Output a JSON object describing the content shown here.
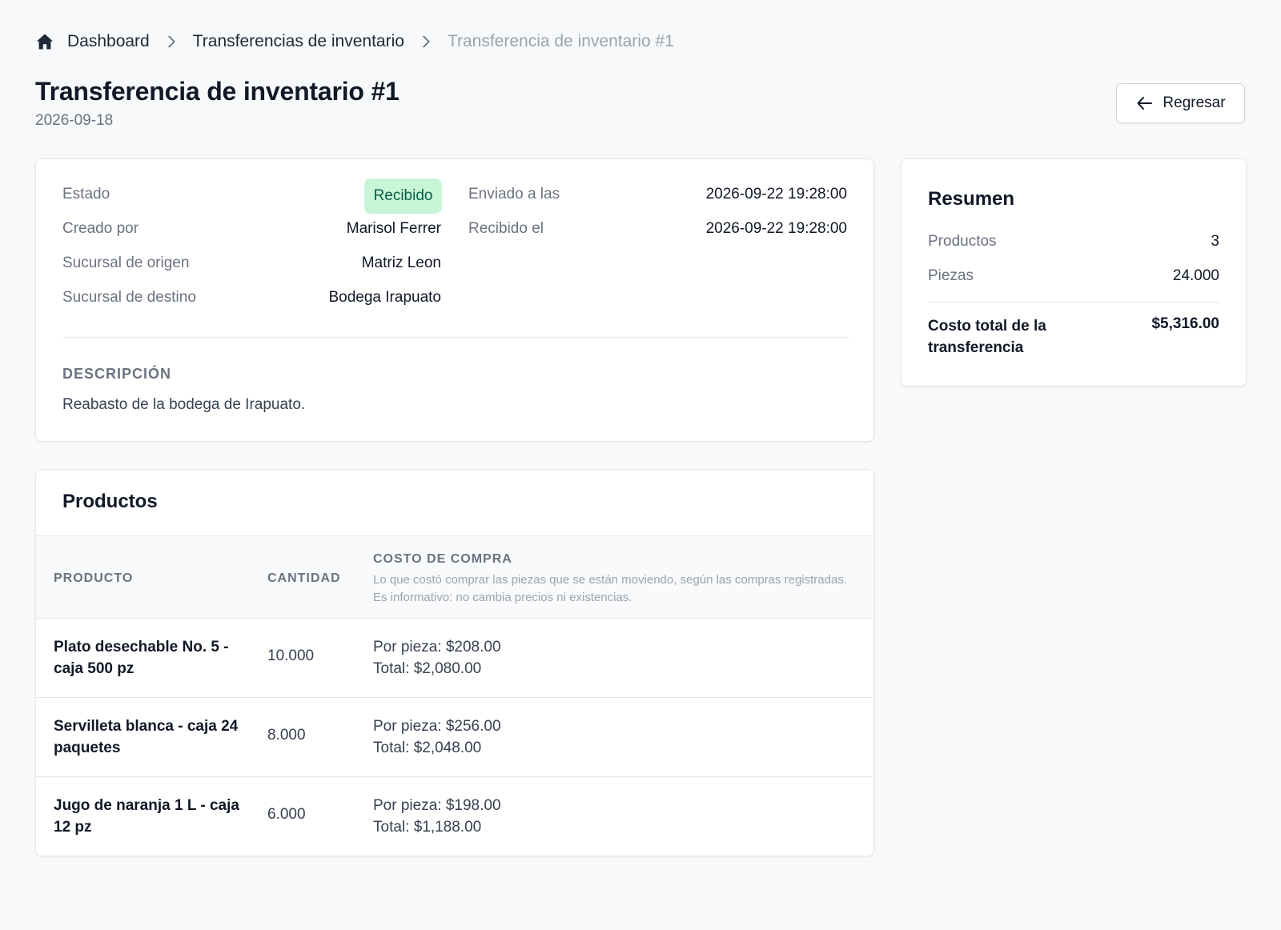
{
  "breadcrumb": {
    "items": [
      {
        "label": "Dashboard"
      },
      {
        "label": "Transferencias de inventario"
      },
      {
        "label": "Transferencia de inventario #1"
      }
    ]
  },
  "header": {
    "title": "Transferencia de inventario #1",
    "date": "2026-09-18",
    "back_label": "Regresar"
  },
  "details": {
    "estado_label": "Estado",
    "estado_value": "Recibido",
    "creado_label": "Creado por",
    "creado_value": "Marisol Ferrer",
    "origen_label": "Sucursal de origen",
    "origen_value": "Matriz Leon",
    "destino_label": "Sucursal de destino",
    "destino_value": "Bodega Irapuato",
    "enviado_label": "Enviado a las",
    "enviado_value": "2026-09-22 19:28:00",
    "recibido_label": "Recibido el",
    "recibido_value": "2026-09-22 19:28:00",
    "descripcion_label": "DESCRIPCIÓN",
    "descripcion_text": "Reabasto de la bodega de Irapuato."
  },
  "summary": {
    "title": "Resumen",
    "productos_label": "Productos",
    "productos_value": "3",
    "piezas_label": "Piezas",
    "piezas_value": "24.000",
    "costo_label": "Costo total de la transferencia",
    "costo_value": "$5,316.00"
  },
  "products": {
    "title": "Productos",
    "columns": {
      "producto": "PRODUCTO",
      "cantidad": "CANTIDAD",
      "costo": "COSTO DE COMPRA",
      "costo_note": "Lo que costó comprar las piezas que se están moviendo, según las compras registradas. Es informativo: no cambia precios ni existencias."
    },
    "rows": [
      {
        "producto": "Plato desechable No. 5 - caja 500 pz",
        "cantidad": "10.000",
        "por_pieza": "Por pieza: $208.00",
        "total": "Total: $2,080.00"
      },
      {
        "producto": "Servilleta blanca - caja 24 paquetes",
        "cantidad": "8.000",
        "por_pieza": "Por pieza: $256.00",
        "total": "Total: $2,048.00"
      },
      {
        "producto": "Jugo de naranja 1 L - caja 12 pz",
        "cantidad": "6.000",
        "por_pieza": "Por pieza: $198.00",
        "total": "Total: $1,188.00"
      }
    ]
  },
  "colors": {
    "badge_bg": "#c8f5d6",
    "badge_text": "#065f46",
    "page_bg": "#f8f9fb"
  }
}
